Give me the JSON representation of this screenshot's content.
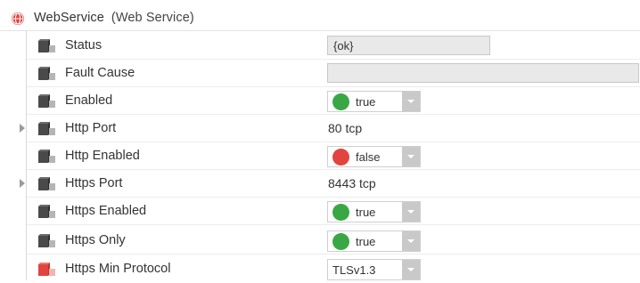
{
  "header": {
    "name": "WebService",
    "type": "(Web Service)",
    "icon": "globe-icon"
  },
  "colors": {
    "true_dot": "#3aa745",
    "false_dot": "#e0453f",
    "slot_icon": "#4a4a4a",
    "slot_icon_highlight": "#e0453f"
  },
  "rows": [
    {
      "label": "Status",
      "value": "{ok}",
      "kind": "readonly-field"
    },
    {
      "label": "Fault Cause",
      "value": "",
      "kind": "readonly-field"
    },
    {
      "label": "Enabled",
      "value": "true",
      "kind": "boolean-select"
    },
    {
      "label": "Http Port",
      "value": "80 tcp",
      "kind": "expandable"
    },
    {
      "label": "Http Enabled",
      "value": "false",
      "kind": "boolean-select"
    },
    {
      "label": "Https Port",
      "value": "8443 tcp",
      "kind": "expandable"
    },
    {
      "label": "Https Enabled",
      "value": "true",
      "kind": "boolean-select"
    },
    {
      "label": "Https Only",
      "value": "true",
      "kind": "boolean-select"
    },
    {
      "label": "Https Min Protocol",
      "value": "TLSv1.3",
      "kind": "enum-select"
    }
  ]
}
